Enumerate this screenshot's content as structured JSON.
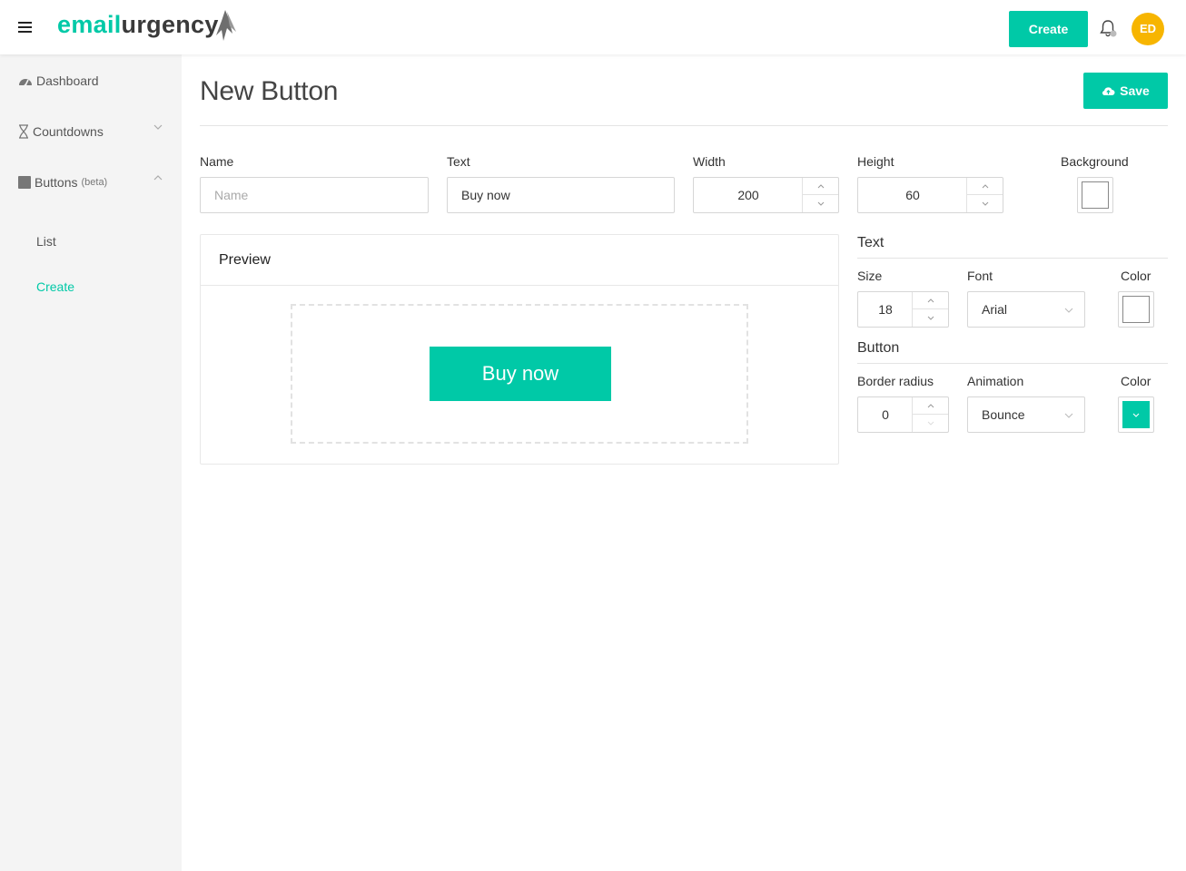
{
  "header": {
    "logo_part1": "email",
    "logo_part2": "urgency",
    "create_label": "Create",
    "avatar_initials": "ED"
  },
  "sidebar": {
    "dashboard": "Dashboard",
    "countdowns": "Countdowns",
    "buttons": "Buttons",
    "buttons_badge": "(beta)",
    "sub_list": "List",
    "sub_create": "Create"
  },
  "page": {
    "title": "New Button",
    "save_label": "Save"
  },
  "form": {
    "name_label": "Name",
    "name_placeholder": "Name",
    "name_value": "",
    "text_label": "Text",
    "text_value": "Buy now",
    "width_label": "Width",
    "width_value": "200",
    "height_label": "Height",
    "height_value": "60",
    "background_label": "Background",
    "background_color": "#ffffff"
  },
  "text_section": {
    "heading": "Text",
    "size_label": "Size",
    "size_value": "18",
    "font_label": "Font",
    "font_value": "Arial",
    "color_label": "Color",
    "color_value": "#ffffff"
  },
  "button_section": {
    "heading": "Button",
    "radius_label": "Border radius",
    "radius_value": "0",
    "animation_label": "Animation",
    "animation_value": "Bounce",
    "color_label": "Color",
    "color_value": "#00c9a7"
  },
  "preview": {
    "title": "Preview",
    "button_text": "Buy now"
  },
  "colors": {
    "accent": "#00c9a7",
    "avatar": "#f7b500"
  }
}
